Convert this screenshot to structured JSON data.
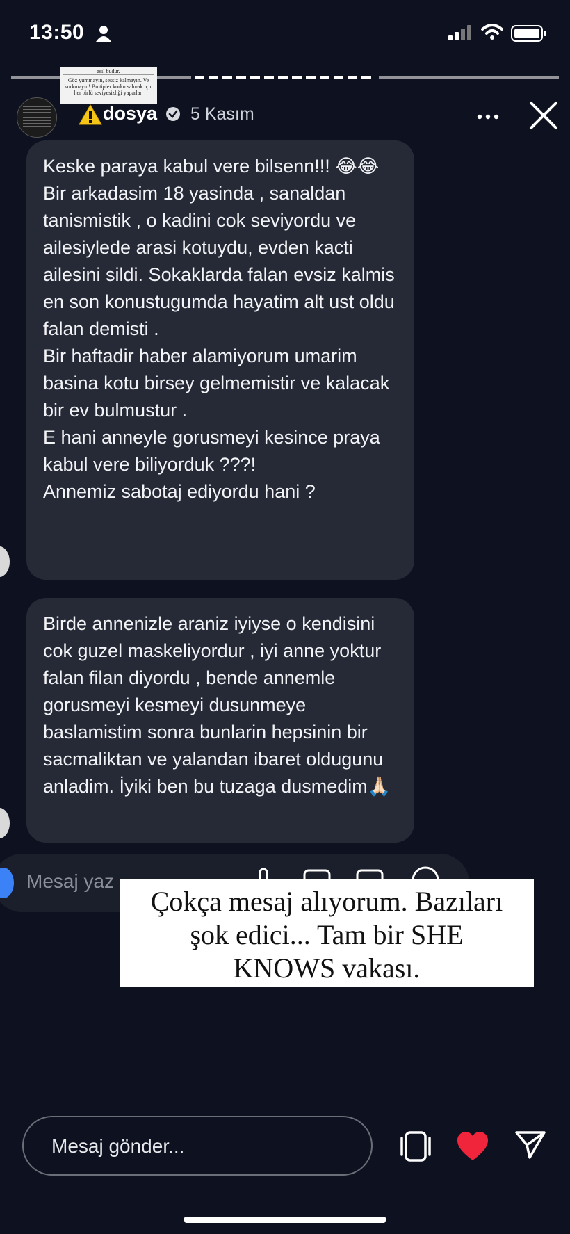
{
  "status_bar": {
    "time": "13:50"
  },
  "story": {
    "thumbnail_note": {
      "top": "asıl budur.",
      "body": "Göz yummayın, sessiz kalmayın. Ve korkmayın! Bu tipler korku salmak için her türlü seviyesizliği yaparlar."
    },
    "username": "dosya",
    "date": "5 Kasım"
  },
  "messages": [
    {
      "text": "Keske paraya kabul vere bilsenn!!! 😂😂\nBir arkadasim 18 yasinda , sanaldan tanismistik , o kadini cok seviyordu ve ailesiylede arasi kotuydu, evden kacti ailesini sildi. Sokaklarda falan evsiz kalmis en son konustugumda hayatim alt ust oldu falan demisti .\nBir haftadir haber  alamiyorum umarim basina kotu birsey gelmemistir  ve kalacak bir ev bulmustur .\nE hani anneyle gorusmeyi kesince praya kabul vere biliyorduk ???!\nAnnemiz sabotaj ediyordu hani ?"
    },
    {
      "text": "Birde annenizle araniz iyiyse o kendisini cok guzel maskeliyordur , iyi anne yoktur falan filan diyordu , bende annemle gorusmeyi kesmeyi dusunmeye baslamistim sonra bunlarin hepsinin bir sacmaliktan ve yalandan ibaret oldugunu anladim. İyiki ben bu tuzaga dusmedim🙏🏻"
    }
  ],
  "inner_composer_placeholder": "Mesaj yaz",
  "caption": "Çokça mesaj alıyorum. Bazıları\nşok edici... Tam bir SHE\nKNOWS vakası.",
  "composer": {
    "placeholder": "Mesaj gönder..."
  },
  "colors": {
    "heart": "#f0243a",
    "bubble": "#262a36",
    "background": "#0e1220"
  }
}
